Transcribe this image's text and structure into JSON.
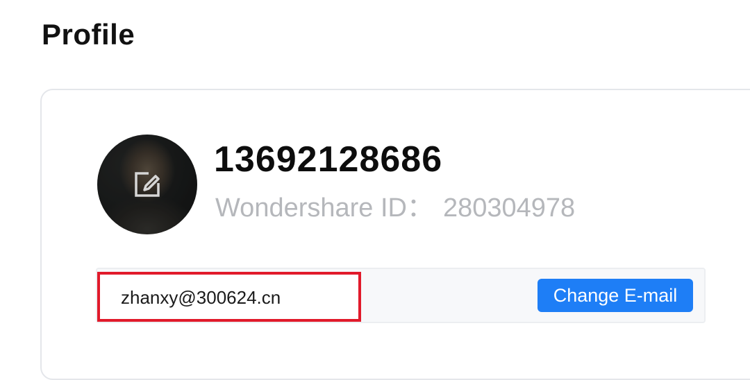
{
  "page": {
    "title": "Profile"
  },
  "profile": {
    "avatar_icon": "edit-icon",
    "username": "13692128686",
    "id_label": "Wondershare ID：",
    "id_value": "280304978"
  },
  "email": {
    "value": "zhanxy@300624.cn",
    "change_button_label": "Change E-mail",
    "button_color": "#1e7ef6",
    "highlight_color": "#e11a2b"
  }
}
